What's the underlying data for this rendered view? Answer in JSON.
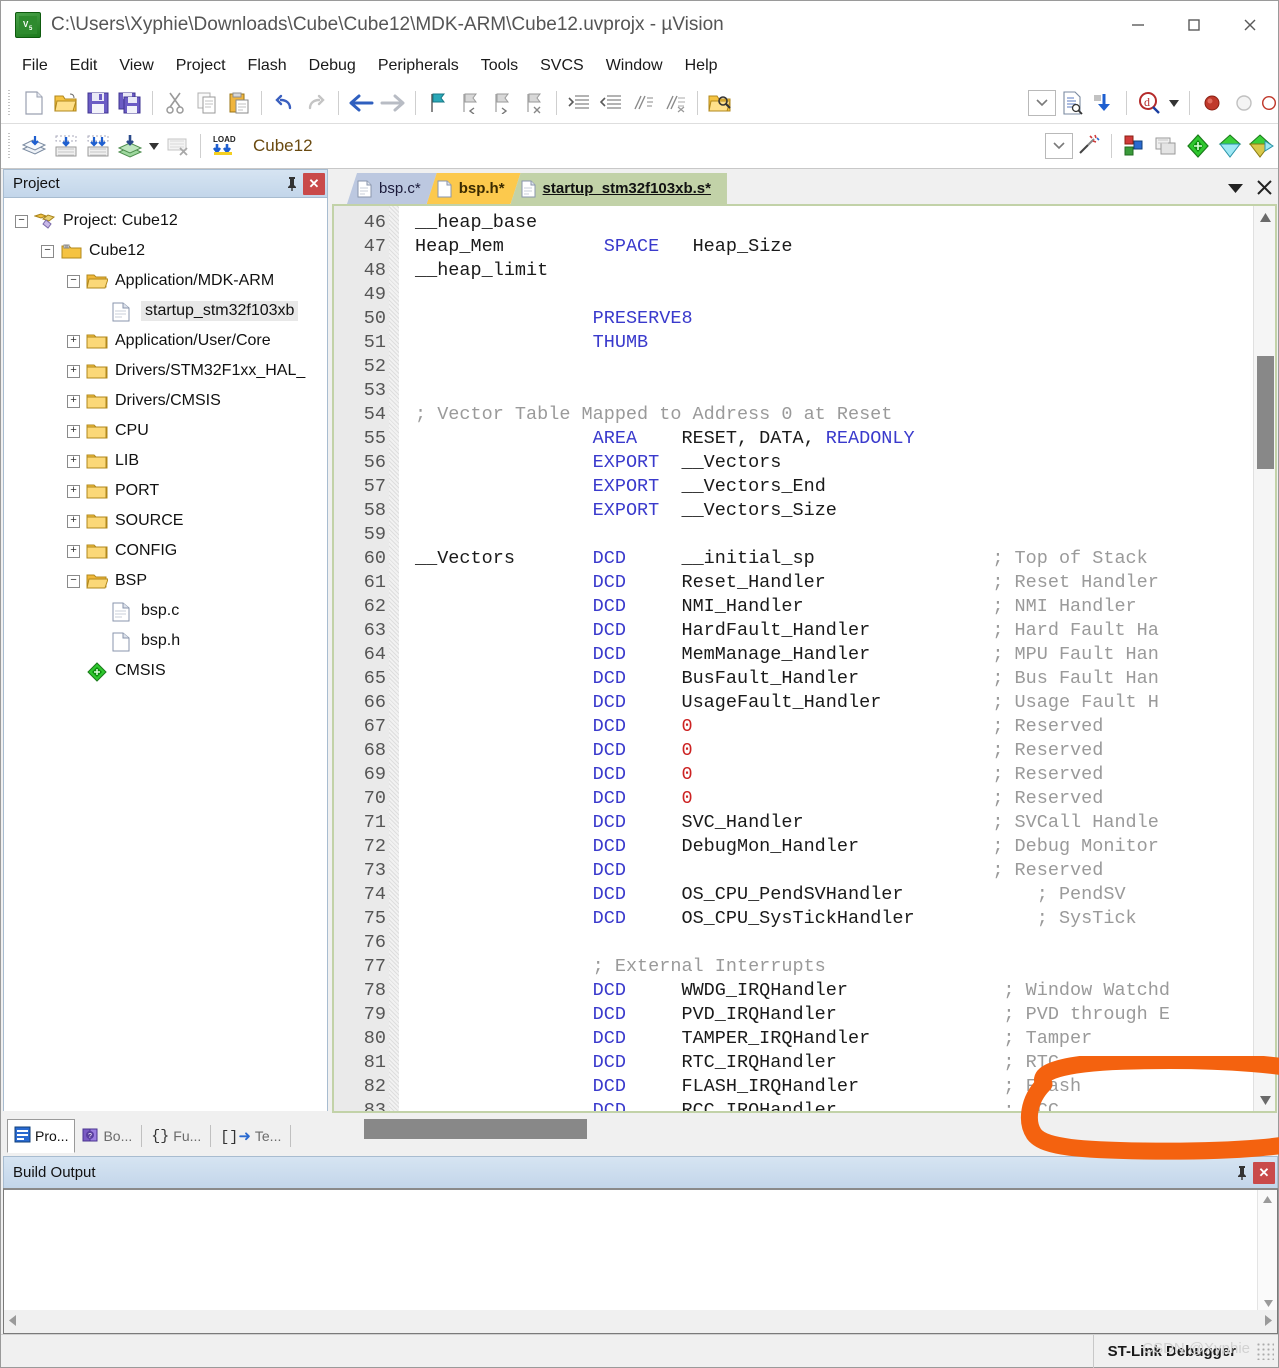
{
  "window": {
    "title": "C:\\Users\\Xyphie\\Downloads\\Cube\\Cube12\\MDK-ARM\\Cube12.uvprojx - µVision",
    "app_icon": "uvision-icon",
    "minimize": "—",
    "maximize": "□",
    "close": "✕"
  },
  "menubar": [
    {
      "label": "File"
    },
    {
      "label": "Edit"
    },
    {
      "label": "View"
    },
    {
      "label": "Project"
    },
    {
      "label": "Flash"
    },
    {
      "label": "Debug"
    },
    {
      "label": "Peripherals"
    },
    {
      "label": "Tools"
    },
    {
      "label": "SVCS"
    },
    {
      "label": "Window"
    },
    {
      "label": "Help"
    }
  ],
  "toolbar_main": {
    "icons": [
      "new-file-icon",
      "open-file-icon",
      "save-icon",
      "save-all-icon",
      "cut-icon",
      "copy-icon",
      "paste-icon",
      "undo-icon",
      "redo-icon",
      "navigate-back-icon",
      "navigate-forward-icon",
      "bookmark-toggle-icon",
      "bookmark-prev-icon",
      "bookmark-next-icon",
      "bookmark-clear-icon",
      "indent-icon",
      "outdent-icon",
      "comment-icon",
      "uncomment-icon",
      "find-in-files-icon"
    ],
    "right_icons": [
      "configure-dropdown-icon",
      "text-file-icon",
      "bind-icon",
      "debug-search-icon",
      "debug-search-dropdown-icon",
      "breakpoint-icon",
      "breakpoint-disabled-icon",
      "breakpoint-clear-icon"
    ]
  },
  "toolbar_build": {
    "icons": [
      "translate-icon",
      "build-icon",
      "rebuild-icon",
      "batch-build-icon",
      "batch-build-dropdown-icon",
      "stop-build-icon",
      "download-icon"
    ],
    "project_selected": "Cube12",
    "right_icons": [
      "target-options-icon",
      "manage-runtime-icon",
      "multi-project-icon",
      "pack-installer-icon",
      "manage-project-items-icon",
      "components-icon"
    ]
  },
  "project_panel": {
    "title": "Project",
    "pin_icon": "pin-icon",
    "close_icon": "close-icon",
    "tree": [
      {
        "label": "Project: Cube12",
        "depth": 0,
        "state": "expanded",
        "icon": "project-icon",
        "selected": false
      },
      {
        "label": "Cube12",
        "depth": 1,
        "state": "expanded",
        "icon": "target-icon",
        "selected": false
      },
      {
        "label": "Application/MDK-ARM",
        "depth": 2,
        "state": "expanded",
        "icon": "folder-open-icon",
        "selected": false
      },
      {
        "label": "startup_stm32f103xb",
        "depth": 3,
        "state": "leaf",
        "icon": "asm-file-icon",
        "selected": true
      },
      {
        "label": "Application/User/Core",
        "depth": 2,
        "state": "collapsed",
        "icon": "folder-icon",
        "selected": false
      },
      {
        "label": "Drivers/STM32F1xx_HAL_",
        "depth": 2,
        "state": "collapsed",
        "icon": "folder-icon",
        "selected": false
      },
      {
        "label": "Drivers/CMSIS",
        "depth": 2,
        "state": "collapsed",
        "icon": "folder-icon",
        "selected": false
      },
      {
        "label": "CPU",
        "depth": 2,
        "state": "collapsed",
        "icon": "folder-icon",
        "selected": false
      },
      {
        "label": "LIB",
        "depth": 2,
        "state": "collapsed",
        "icon": "folder-icon",
        "selected": false
      },
      {
        "label": "PORT",
        "depth": 2,
        "state": "collapsed",
        "icon": "folder-icon",
        "selected": false
      },
      {
        "label": "SOURCE",
        "depth": 2,
        "state": "collapsed",
        "icon": "folder-icon",
        "selected": false
      },
      {
        "label": "CONFIG",
        "depth": 2,
        "state": "collapsed",
        "icon": "folder-icon",
        "selected": false
      },
      {
        "label": "BSP",
        "depth": 2,
        "state": "expanded",
        "icon": "folder-open-icon",
        "selected": false
      },
      {
        "label": "bsp.c",
        "depth": 3,
        "state": "leaf",
        "icon": "c-file-icon",
        "selected": false
      },
      {
        "label": "bsp.h",
        "depth": 3,
        "state": "leaf",
        "icon": "h-file-icon",
        "selected": false
      },
      {
        "label": "CMSIS",
        "depth": 2,
        "state": "leaf",
        "icon": "cmsis-icon",
        "selected": false
      }
    ]
  },
  "left_tabs": [
    {
      "label": "Pro...",
      "icon": "project-tab-icon",
      "active": true
    },
    {
      "label": "Bo...",
      "icon": "books-tab-icon",
      "active": false
    },
    {
      "label": "Fu...",
      "icon": "functions-tab-icon",
      "active": false
    },
    {
      "label": "Te...",
      "icon": "templates-tab-icon",
      "active": false
    }
  ],
  "editor": {
    "tabs": [
      {
        "label": "bsp.c*",
        "kind": "c",
        "icon": "c-file-icon",
        "active": false
      },
      {
        "label": "bsp.h*",
        "kind": "h",
        "icon": "h-file-icon",
        "active": false
      },
      {
        "label": "startup_stm32f103xb.s*",
        "kind": "s",
        "icon": "asm-file-icon",
        "active": true
      }
    ],
    "tab_dropdown_icon": "chevron-down-icon",
    "tab_close_icon": "close-icon",
    "first_line": 46,
    "lines": [
      {
        "n": 46,
        "segs": [
          {
            "t": "__heap_base",
            "c": "id"
          }
        ]
      },
      {
        "n": 47,
        "segs": [
          {
            "t": "Heap_Mem",
            "c": "id"
          },
          {
            "t": "         ",
            "c": "id"
          },
          {
            "t": "SPACE",
            "c": "dir"
          },
          {
            "t": "   ",
            "c": "id"
          },
          {
            "t": "Heap_Size",
            "c": "id"
          }
        ]
      },
      {
        "n": 48,
        "segs": [
          {
            "t": "__heap_limit",
            "c": "id"
          }
        ]
      },
      {
        "n": 49,
        "segs": []
      },
      {
        "n": 50,
        "segs": [
          {
            "t": "                ",
            "c": "id"
          },
          {
            "t": "PRESERVE8",
            "c": "dir"
          }
        ]
      },
      {
        "n": 51,
        "segs": [
          {
            "t": "                ",
            "c": "id"
          },
          {
            "t": "THUMB",
            "c": "dir"
          }
        ]
      },
      {
        "n": 52,
        "segs": []
      },
      {
        "n": 53,
        "segs": []
      },
      {
        "n": 54,
        "segs": [
          {
            "t": "; Vector Table Mapped to Address 0 at Reset",
            "c": "cmt"
          }
        ]
      },
      {
        "n": 55,
        "segs": [
          {
            "t": "                ",
            "c": "id"
          },
          {
            "t": "AREA",
            "c": "dir"
          },
          {
            "t": "    RESET, DATA, ",
            "c": "id"
          },
          {
            "t": "READONLY",
            "c": "dir"
          }
        ]
      },
      {
        "n": 56,
        "segs": [
          {
            "t": "                ",
            "c": "id"
          },
          {
            "t": "EXPORT",
            "c": "dir"
          },
          {
            "t": "  __Vectors",
            "c": "id"
          }
        ]
      },
      {
        "n": 57,
        "segs": [
          {
            "t": "                ",
            "c": "id"
          },
          {
            "t": "EXPORT",
            "c": "dir"
          },
          {
            "t": "  __Vectors_End",
            "c": "id"
          }
        ]
      },
      {
        "n": 58,
        "segs": [
          {
            "t": "                ",
            "c": "id"
          },
          {
            "t": "EXPORT",
            "c": "dir"
          },
          {
            "t": "  __Vectors_Size",
            "c": "id"
          }
        ]
      },
      {
        "n": 59,
        "segs": []
      },
      {
        "n": 60,
        "segs": [
          {
            "t": "__Vectors       ",
            "c": "id"
          },
          {
            "t": "DCD",
            "c": "dir"
          },
          {
            "t": "     __initial_sp                ",
            "c": "id"
          },
          {
            "t": "; Top of Stack",
            "c": "cmt"
          }
        ]
      },
      {
        "n": 61,
        "segs": [
          {
            "t": "                ",
            "c": "id"
          },
          {
            "t": "DCD",
            "c": "dir"
          },
          {
            "t": "     Reset_Handler               ",
            "c": "id"
          },
          {
            "t": "; Reset Handler",
            "c": "cmt"
          }
        ]
      },
      {
        "n": 62,
        "segs": [
          {
            "t": "                ",
            "c": "id"
          },
          {
            "t": "DCD",
            "c": "dir"
          },
          {
            "t": "     NMI_Handler                 ",
            "c": "id"
          },
          {
            "t": "; NMI Handler",
            "c": "cmt"
          }
        ]
      },
      {
        "n": 63,
        "segs": [
          {
            "t": "                ",
            "c": "id"
          },
          {
            "t": "DCD",
            "c": "dir"
          },
          {
            "t": "     HardFault_Handler           ",
            "c": "id"
          },
          {
            "t": "; Hard Fault Ha",
            "c": "cmt"
          }
        ]
      },
      {
        "n": 64,
        "segs": [
          {
            "t": "                ",
            "c": "id"
          },
          {
            "t": "DCD",
            "c": "dir"
          },
          {
            "t": "     MemManage_Handler           ",
            "c": "id"
          },
          {
            "t": "; MPU Fault Han",
            "c": "cmt"
          }
        ]
      },
      {
        "n": 65,
        "segs": [
          {
            "t": "                ",
            "c": "id"
          },
          {
            "t": "DCD",
            "c": "dir"
          },
          {
            "t": "     BusFault_Handler            ",
            "c": "id"
          },
          {
            "t": "; Bus Fault Han",
            "c": "cmt"
          }
        ]
      },
      {
        "n": 66,
        "segs": [
          {
            "t": "                ",
            "c": "id"
          },
          {
            "t": "DCD",
            "c": "dir"
          },
          {
            "t": "     UsageFault_Handler          ",
            "c": "id"
          },
          {
            "t": "; Usage Fault H",
            "c": "cmt"
          }
        ]
      },
      {
        "n": 67,
        "segs": [
          {
            "t": "                ",
            "c": "id"
          },
          {
            "t": "DCD",
            "c": "dir"
          },
          {
            "t": "     ",
            "c": "id"
          },
          {
            "t": "0",
            "c": "num"
          },
          {
            "t": "                           ",
            "c": "id"
          },
          {
            "t": "; Reserved",
            "c": "cmt"
          }
        ]
      },
      {
        "n": 68,
        "segs": [
          {
            "t": "                ",
            "c": "id"
          },
          {
            "t": "DCD",
            "c": "dir"
          },
          {
            "t": "     ",
            "c": "id"
          },
          {
            "t": "0",
            "c": "num"
          },
          {
            "t": "                           ",
            "c": "id"
          },
          {
            "t": "; Reserved",
            "c": "cmt"
          }
        ]
      },
      {
        "n": 69,
        "segs": [
          {
            "t": "                ",
            "c": "id"
          },
          {
            "t": "DCD",
            "c": "dir"
          },
          {
            "t": "     ",
            "c": "id"
          },
          {
            "t": "0",
            "c": "num"
          },
          {
            "t": "                           ",
            "c": "id"
          },
          {
            "t": "; Reserved",
            "c": "cmt"
          }
        ]
      },
      {
        "n": 70,
        "segs": [
          {
            "t": "                ",
            "c": "id"
          },
          {
            "t": "DCD",
            "c": "dir"
          },
          {
            "t": "     ",
            "c": "id"
          },
          {
            "t": "0",
            "c": "num"
          },
          {
            "t": "                           ",
            "c": "id"
          },
          {
            "t": "; Reserved",
            "c": "cmt"
          }
        ]
      },
      {
        "n": 71,
        "segs": [
          {
            "t": "                ",
            "c": "id"
          },
          {
            "t": "DCD",
            "c": "dir"
          },
          {
            "t": "     SVC_Handler                 ",
            "c": "id"
          },
          {
            "t": "; SVCall Handle",
            "c": "cmt"
          }
        ]
      },
      {
        "n": 72,
        "segs": [
          {
            "t": "                ",
            "c": "id"
          },
          {
            "t": "DCD",
            "c": "dir"
          },
          {
            "t": "     DebugMon_Handler            ",
            "c": "id"
          },
          {
            "t": "; Debug Monitor",
            "c": "cmt"
          }
        ]
      },
      {
        "n": 73,
        "segs": [
          {
            "t": "                ",
            "c": "id"
          },
          {
            "t": "DCD",
            "c": "dir"
          },
          {
            "t": "                                 ",
            "c": "id"
          },
          {
            "t": "; Reserved",
            "c": "cmt"
          }
        ]
      },
      {
        "n": 74,
        "segs": [
          {
            "t": "                ",
            "c": "id"
          },
          {
            "t": "DCD",
            "c": "dir"
          },
          {
            "t": "     OS_CPU_PendSVHandler            ",
            "c": "id"
          },
          {
            "t": "; PendSV ",
            "c": "cmt"
          }
        ]
      },
      {
        "n": 75,
        "segs": [
          {
            "t": "                ",
            "c": "id"
          },
          {
            "t": "DCD",
            "c": "dir"
          },
          {
            "t": "     OS_CPU_SysTickHandler           ",
            "c": "id"
          },
          {
            "t": "; SysTick",
            "c": "cmt"
          }
        ]
      },
      {
        "n": 76,
        "segs": []
      },
      {
        "n": 77,
        "segs": [
          {
            "t": "                ",
            "c": "id"
          },
          {
            "t": "; External Interrupts",
            "c": "cmt"
          }
        ]
      },
      {
        "n": 78,
        "segs": [
          {
            "t": "                ",
            "c": "id"
          },
          {
            "t": "DCD",
            "c": "dir"
          },
          {
            "t": "     WWDG_IRQHandler              ",
            "c": "id"
          },
          {
            "t": "; Window Watchd",
            "c": "cmt"
          }
        ]
      },
      {
        "n": 79,
        "segs": [
          {
            "t": "                ",
            "c": "id"
          },
          {
            "t": "DCD",
            "c": "dir"
          },
          {
            "t": "     PVD_IRQHandler               ",
            "c": "id"
          },
          {
            "t": "; PVD through E",
            "c": "cmt"
          }
        ]
      },
      {
        "n": 80,
        "segs": [
          {
            "t": "                ",
            "c": "id"
          },
          {
            "t": "DCD",
            "c": "dir"
          },
          {
            "t": "     TAMPER_IRQHandler            ",
            "c": "id"
          },
          {
            "t": "; Tamper",
            "c": "cmt"
          }
        ]
      },
      {
        "n": 81,
        "segs": [
          {
            "t": "                ",
            "c": "id"
          },
          {
            "t": "DCD",
            "c": "dir"
          },
          {
            "t": "     RTC_IRQHandler               ",
            "c": "id"
          },
          {
            "t": "; RTC",
            "c": "cmt"
          }
        ]
      },
      {
        "n": 82,
        "segs": [
          {
            "t": "                ",
            "c": "id"
          },
          {
            "t": "DCD",
            "c": "dir"
          },
          {
            "t": "     FLASH_IRQHandler             ",
            "c": "id"
          },
          {
            "t": "; Flash",
            "c": "cmt"
          }
        ]
      },
      {
        "n": 83,
        "segs": [
          {
            "t": "                ",
            "c": "id"
          },
          {
            "t": "DCD",
            "c": "dir"
          },
          {
            "t": "     RCC_IRQHandler               ",
            "c": "id"
          },
          {
            "t": "; RCC",
            "c": "cmt"
          }
        ]
      }
    ],
    "annotation": {
      "shape": "hand-drawn-rounded-rectangle",
      "color": "#f4620f",
      "encircles": [
        "OS_CPU_PendSVHandler",
        "OS_CPU_SysTickHandler"
      ]
    }
  },
  "build_output": {
    "title": "Build Output",
    "pin_icon": "pin-icon",
    "close_icon": "close-icon",
    "content": ""
  },
  "statusbar": {
    "debugger": "ST-Link Debugger",
    "watermark": "CSDN @Xyphie"
  },
  "colors": {
    "annotation_orange": "#f4620f",
    "directive_blue": "#3a3acc",
    "number_red": "#cc2222",
    "comment_gray": "#9a9a9a",
    "active_tab_green": "#c2d2a8",
    "h_tab_yellow": "#fcc94d",
    "c_tab_blue": "#bcc8e0",
    "panel_header_blue": "#c3d6ea"
  }
}
